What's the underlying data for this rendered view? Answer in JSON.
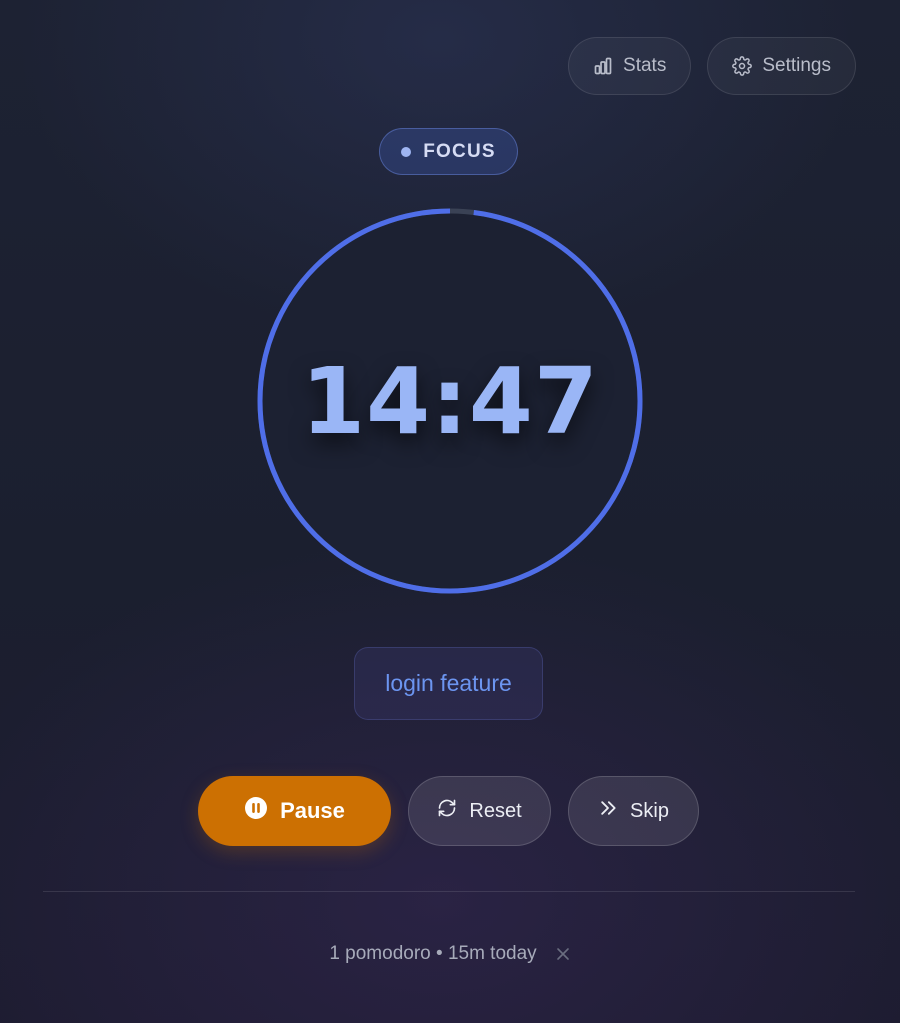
{
  "header": {
    "stats_label": "Stats",
    "settings_label": "Settings"
  },
  "mode": {
    "label": "FOCUS"
  },
  "timer": {
    "display": "14:47",
    "progress_fraction": 0.02
  },
  "task": {
    "label": "login feature"
  },
  "controls": {
    "pause_label": "Pause",
    "reset_label": "Reset",
    "skip_label": "Skip"
  },
  "footer": {
    "summary": "1 pomodoro • 15m today"
  },
  "colors": {
    "accent": "#4f6ee8",
    "pause": "#cc7002",
    "time": "#9ab6f6",
    "task": "#6c95f0"
  },
  "icons": {
    "stats": "bar-chart-icon",
    "settings": "gear-icon",
    "pause": "pause-circle-icon",
    "reset": "refresh-icon",
    "skip": "double-chevron-right-icon",
    "close": "close-icon"
  }
}
